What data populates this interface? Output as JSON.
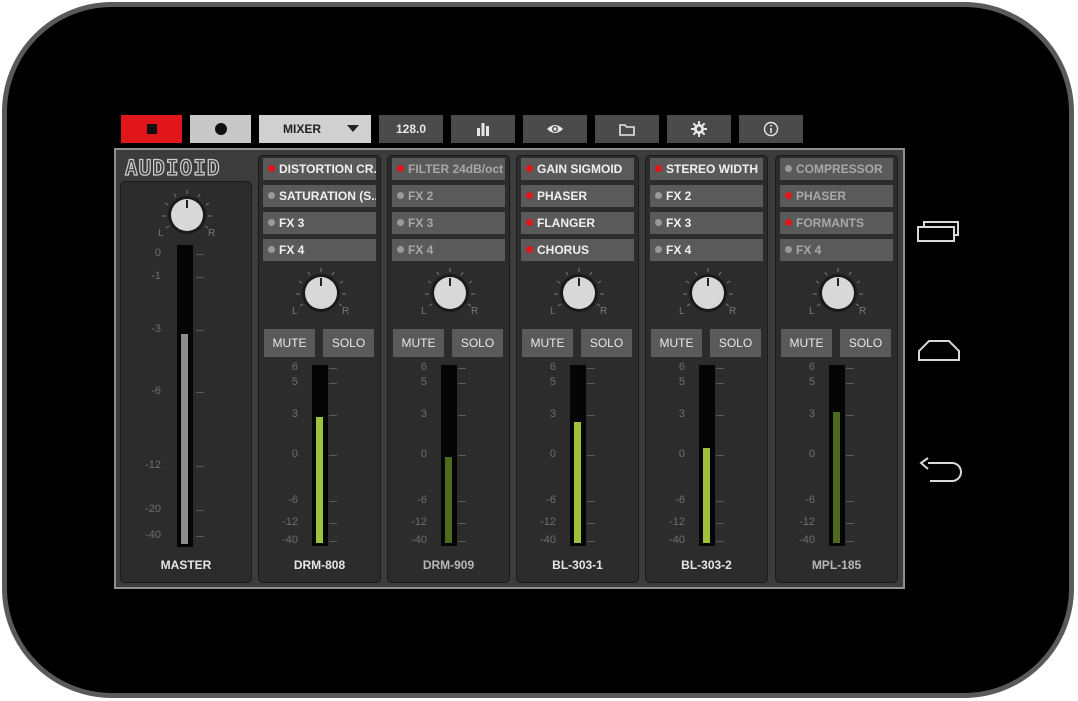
{
  "toolbar": {
    "stop_icon": "stop-icon",
    "record_icon": "record-icon",
    "view_select": "MIXER",
    "tempo": "128.0",
    "icons": [
      "equalizer-icon",
      "eye-icon",
      "folder-icon",
      "gear-icon",
      "info-icon"
    ]
  },
  "colors": {
    "accent_red": "#e0161a",
    "meter_green": "#9ec23c",
    "meter_green_dim": "#4f6a1e",
    "panel": "#3c3c3c"
  },
  "logo": "AUDIOID",
  "master": {
    "name": "MASTER",
    "pan_left": "L",
    "pan_right": "R",
    "scale": [
      "0",
      "-1",
      "-3",
      "-6",
      "-12",
      "-20",
      "-40"
    ],
    "level": 0.82
  },
  "scale_labels": [
    "6",
    "5",
    "3",
    "0",
    "-6",
    "-12",
    "-40"
  ],
  "pan_labels": {
    "left": "L",
    "right": "R"
  },
  "mute_label": "MUTE",
  "solo_label": "SOLO",
  "channels": [
    {
      "name": "DRM-808",
      "dim": false,
      "level": 0.72,
      "active": true,
      "fx": [
        {
          "label": "DISTORTION CR...",
          "on": true
        },
        {
          "label": "SATURATION (S...",
          "on": false
        },
        {
          "label": "FX 3",
          "on": false
        },
        {
          "label": "FX 4",
          "on": false
        }
      ]
    },
    {
      "name": "DRM-909",
      "dim": true,
      "level": 0.49,
      "active": false,
      "fx": [
        {
          "label": "FILTER 24dB/oct",
          "on": true
        },
        {
          "label": "FX 2",
          "on": false
        },
        {
          "label": "FX 3",
          "on": false
        },
        {
          "label": "FX 4",
          "on": false
        }
      ]
    },
    {
      "name": "BL-303-1",
      "dim": false,
      "level": 0.69,
      "active": true,
      "fx": [
        {
          "label": "GAIN SIGMOID",
          "on": true
        },
        {
          "label": "PHASER",
          "on": true
        },
        {
          "label": "FLANGER",
          "on": true
        },
        {
          "label": "CHORUS",
          "on": true
        }
      ]
    },
    {
      "name": "BL-303-2",
      "dim": false,
      "level": 0.54,
      "active": true,
      "fx": [
        {
          "label": "STEREO WIDTH",
          "on": true
        },
        {
          "label": "FX 2",
          "on": false
        },
        {
          "label": "FX 3",
          "on": false
        },
        {
          "label": "FX 4",
          "on": false
        }
      ]
    },
    {
      "name": "MPL-185",
      "dim": true,
      "level": 0.75,
      "active": false,
      "fx": [
        {
          "label": "COMPRESSOR",
          "on": false
        },
        {
          "label": "PHASER",
          "on": true
        },
        {
          "label": "FORMANTS",
          "on": true
        },
        {
          "label": "FX 4",
          "on": false
        }
      ]
    }
  ],
  "nav": [
    "recent-apps-icon",
    "home-icon",
    "back-icon"
  ]
}
